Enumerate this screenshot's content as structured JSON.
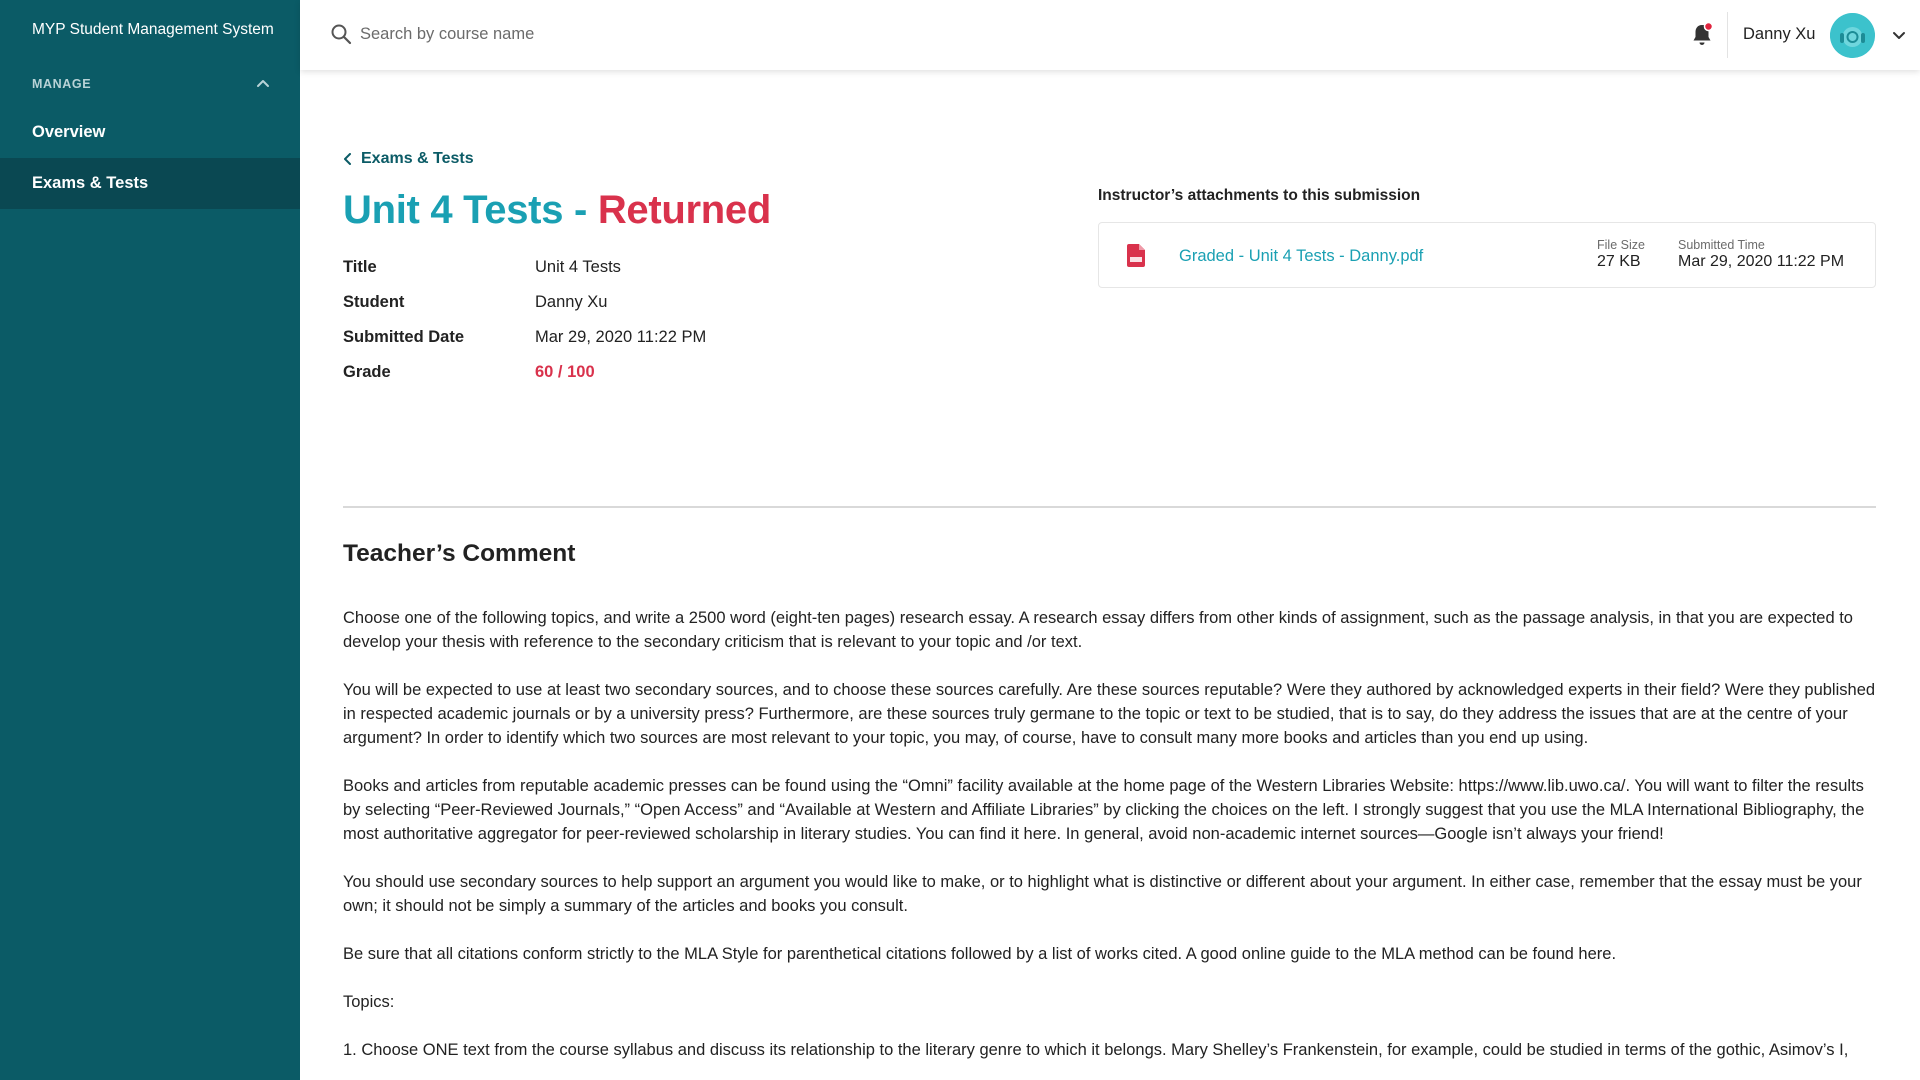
{
  "app": {
    "title": "MYP Student Management System"
  },
  "sidebar": {
    "section_label": "MANAGE",
    "items": [
      {
        "label": "Overview",
        "active": false
      },
      {
        "label": "Exams & Tests",
        "active": true
      }
    ]
  },
  "header": {
    "search_placeholder": "Search by course name",
    "user_name": "Danny Xu",
    "has_notification": true
  },
  "breadcrumb": {
    "back_label": "Exams & Tests"
  },
  "page": {
    "title_main": "Unit 4 Tests",
    "title_sep": " - ",
    "title_status": "Returned"
  },
  "info": {
    "title_label": "Title",
    "title_value": "Unit 4 Tests",
    "student_label": "Student",
    "student_value": "Danny Xu",
    "date_label": "Submitted Date",
    "date_value": "Mar 29, 2020 11:22 PM",
    "grade_label": "Grade",
    "grade_value": "60 / 100"
  },
  "attachments": {
    "heading": "Instructor’s attachments to this submission",
    "file": {
      "name": "Graded - Unit 4 Tests - Danny.pdf",
      "size_label": "File Size",
      "size_value": "27 KB",
      "time_label": "Submitted Time",
      "time_value": "Mar 29, 2020 11:22 PM"
    }
  },
  "comment": {
    "title": "Teacher’s Comment",
    "paragraphs": [
      "Choose one of the following topics, and write a 2500 word (eight-ten pages) research essay. A research essay differs from other kinds of assignment, such as the passage analysis, in that you are expected to develop your thesis with reference to the secondary criticism that is relevant to your topic and /or text.",
      "You will be expected to use at least two secondary sources, and to choose these sources carefully. Are these sources reputable? Were they authored by acknowledged experts in their field? Were they published in respected academic journals or by a university press? Furthermore, are these sources truly germane to the topic or text to be studied, that is to say, do they address the issues that are at the centre of your argument?  In order to identify which two sources are most relevant to your topic, you may, of course, have to consult many more books and articles than you end up using.",
      "Books and articles from reputable academic presses can be found using the “Omni” facility available at the home page of the Western Libraries Website: https://www.lib.uwo.ca/. You will want to filter the results by selecting “Peer-Reviewed Journals,” “Open Access”  and “Available at Western and Affiliate Libraries” by clicking the choices on the left. I strongly suggest that you use the MLA International Bibliography, the most authoritative aggregator for peer-reviewed scholarship in literary studies. You can find it here. In general, avoid non-academic internet sources—Google isn’t always your friend!",
      "You should use secondary sources to help support an argument you would like to make, or to highlight what is distinctive or different about your argument. In either case, remember that the essay must be your own; it should not be simply a summary of the articles and books you consult.",
      "Be sure that all citations conform strictly to the MLA Style for parenthetical citations followed by a list of works cited. A good online guide to the MLA method can be found here.",
      "Topics:",
      "1. Choose ONE text from the course syllabus and discuss its relationship to the literary genre to which it belongs. Mary Shelley’s Frankenstein, for example, could be studied in terms of the gothic, Asimov’s I,"
    ]
  },
  "colors": {
    "sidebar_bg": "#0b5b66",
    "sidebar_active": "#0a4852",
    "accent_teal": "#1aa0b3",
    "status_red": "#d9324c"
  }
}
